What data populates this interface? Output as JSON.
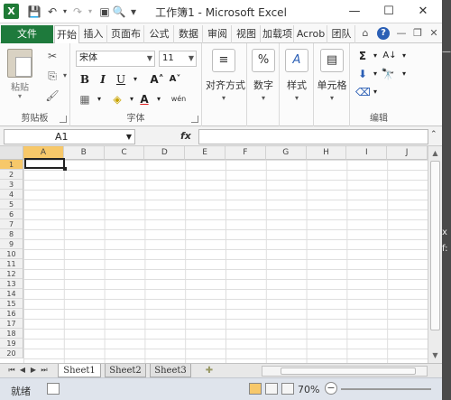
{
  "window": {
    "title": "工作簿1 - Microsoft Excel",
    "app_logo": "X",
    "controls": {
      "minimize": "—",
      "maximize": "☐",
      "close": "✕"
    }
  },
  "quick_access": {
    "save": "💾",
    "undo": "↶",
    "redo": "↷",
    "print_preview": "🔍",
    "customize": "▾"
  },
  "tabs": {
    "file": "文件",
    "items": [
      "开始",
      "插入",
      "页面布",
      "公式",
      "数据",
      "审阅",
      "视图",
      "加载项",
      "Acrob",
      "团队"
    ],
    "active_index": 0,
    "right_icons": [
      "⌂",
      "?",
      "—",
      "❐",
      "✕"
    ]
  },
  "ribbon": {
    "clipboard": {
      "paste": "粘贴",
      "label": "剪贴板",
      "cut_icon": "✂",
      "copy_icon": "⎘",
      "format_painter_icon": "🖌"
    },
    "font": {
      "label": "字体",
      "name": "宋体",
      "size": "11",
      "grow": "A˄",
      "shrink": "A˅",
      "bold": "B",
      "italic": "I",
      "underline": "U",
      "border_icon": "▦",
      "fill_icon": "◈",
      "font_color": "A",
      "phonetic": "wén",
      "accent_font_color": "#e02020",
      "accent_fill_color": "#f2d600"
    },
    "alignment": {
      "label": "对齐方式",
      "icon": "≡"
    },
    "number": {
      "label": "数字",
      "icon": "%"
    },
    "styles": {
      "label": "样式",
      "icon": "A"
    },
    "cells": {
      "label": "单元格",
      "icon": "▤"
    },
    "editing": {
      "label": "编辑",
      "sum_icon": "Σ",
      "sort_icon": "A↓",
      "fill_icon": "⬇",
      "find_icon": "🔭",
      "clear_icon": "⌫"
    }
  },
  "formula_bar": {
    "name_box": "A1",
    "fx": "fx",
    "value": ""
  },
  "sheet": {
    "columns": [
      "A",
      "B",
      "C",
      "D",
      "E",
      "F",
      "G",
      "H",
      "I",
      "J"
    ],
    "rows": [
      "1",
      "2",
      "3",
      "4",
      "5",
      "6",
      "7",
      "8",
      "9",
      "10",
      "11",
      "12",
      "13",
      "14",
      "15",
      "16",
      "17",
      "18",
      "19",
      "20"
    ],
    "active_cell": "A1",
    "selection_color": "#f7c86a"
  },
  "sheet_tabs": {
    "items": [
      "Sheet1",
      "Sheet2",
      "Sheet3"
    ],
    "active_index": 0,
    "new_icon": "✚"
  },
  "status": {
    "ready": "就绪",
    "zoom": "70%",
    "zoom_minus": "−"
  },
  "outside": {
    "x_char": "x",
    "fx_char": "f:",
    "dash_char": "—"
  }
}
